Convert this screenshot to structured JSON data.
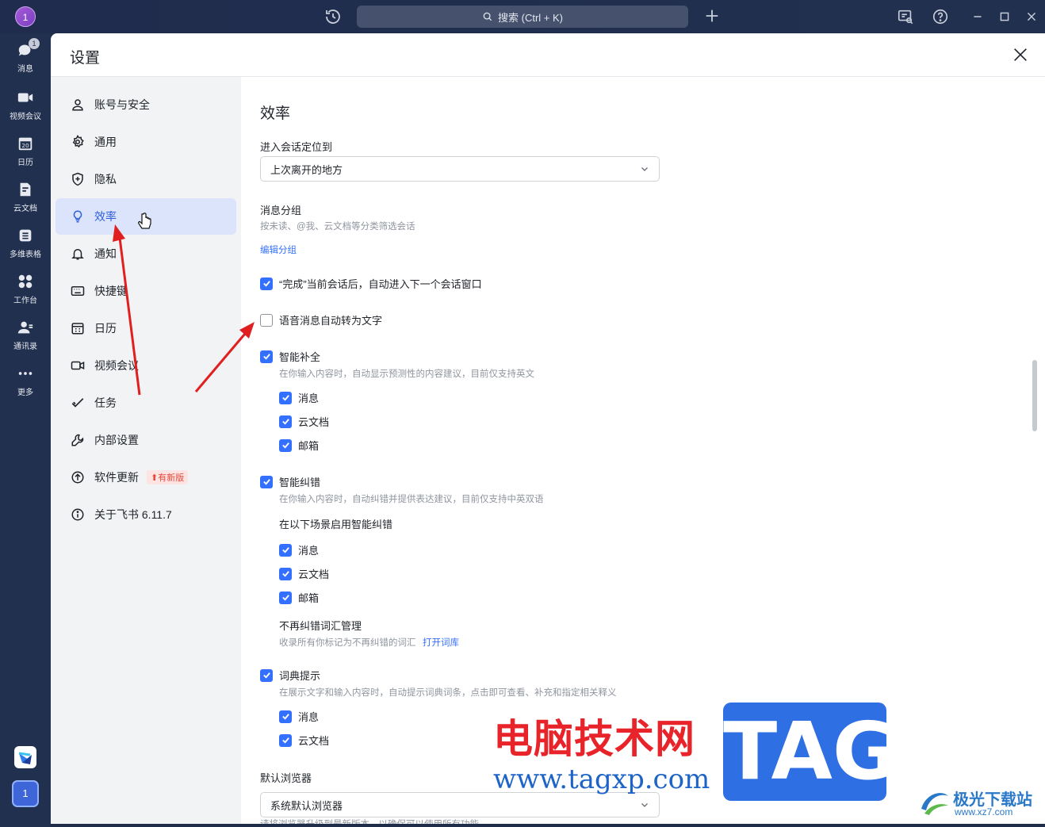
{
  "titlebar": {
    "avatar_text": "1",
    "search_placeholder": "搜索 (Ctrl + K)"
  },
  "rail": {
    "items": [
      {
        "label": "消息",
        "badge": "1"
      },
      {
        "label": "视频会议"
      },
      {
        "label": "日历",
        "icon_text": "20"
      },
      {
        "label": "云文档"
      },
      {
        "label": "多维表格"
      },
      {
        "label": "工作台"
      },
      {
        "label": "通讯录"
      },
      {
        "label": "更多"
      }
    ],
    "user_text": "1"
  },
  "window": {
    "title": "设置"
  },
  "nav": {
    "items": [
      {
        "label": "账号与安全"
      },
      {
        "label": "通用"
      },
      {
        "label": "隐私"
      },
      {
        "label": "效率"
      },
      {
        "label": "通知"
      },
      {
        "label": "快捷键"
      },
      {
        "label": "日历"
      },
      {
        "label": "视频会议"
      },
      {
        "label": "任务"
      },
      {
        "label": "内部设置"
      },
      {
        "label": "软件更新",
        "badge": "有新版"
      },
      {
        "label": "关于飞书 6.11.7"
      }
    ],
    "active_index": 3
  },
  "content": {
    "section_title": "效率",
    "enter_session": {
      "label": "进入会话定位到",
      "value": "上次离开的地方"
    },
    "msg_group": {
      "label": "消息分组",
      "desc": "按未读、@我、云文档等分类筛选会话",
      "link": "编辑分组"
    },
    "done_next": {
      "label": "“完成”当前会话后，自动进入下一个会话窗口",
      "checked": true
    },
    "voice_to_text": {
      "label": "语音消息自动转为文字",
      "checked": false
    },
    "smart_complete": {
      "label": "智能补全",
      "checked": true,
      "desc": "在你输入内容时，自动显示预测性的内容建议，目前仅支持英文",
      "options": [
        {
          "label": "消息"
        },
        {
          "label": "云文档"
        },
        {
          "label": "邮箱"
        }
      ]
    },
    "smart_correct": {
      "label": "智能纠错",
      "checked": true,
      "desc": "在你输入内容时，自动纠错并提供表达建议，目前仅支持中英双语",
      "scene_label": "在以下场景启用智能纠错",
      "options": [
        {
          "label": "消息"
        },
        {
          "label": "云文档"
        },
        {
          "label": "邮箱"
        }
      ],
      "vocab_title": "不再纠错词汇管理",
      "vocab_desc": "收录所有你标记为不再纠错的词汇",
      "vocab_link": "打开词库"
    },
    "dict_hint": {
      "label": "词典提示",
      "checked": true,
      "desc": "在展示文字和输入内容时，自动提示词典词条，点击即可查看、补充和指定相关释义",
      "options": [
        {
          "label": "消息"
        },
        {
          "label": "云文档"
        }
      ]
    },
    "browser": {
      "label": "默认浏览器",
      "value": "系统默认浏览器",
      "desc": "请将浏览器升级到最新版本，以确保可以使用所有功能"
    }
  },
  "watermark": {
    "cn": "电脑技术网",
    "url": "www.tagxp.com",
    "tag": "TAG",
    "logo_cn": "极光下载站",
    "logo_url": "www.xz7.com"
  },
  "colors": {
    "accent": "#3370ff",
    "active_bg": "#dbe4fb",
    "rail_bg": "#22304f",
    "arrow": "#e02020"
  }
}
